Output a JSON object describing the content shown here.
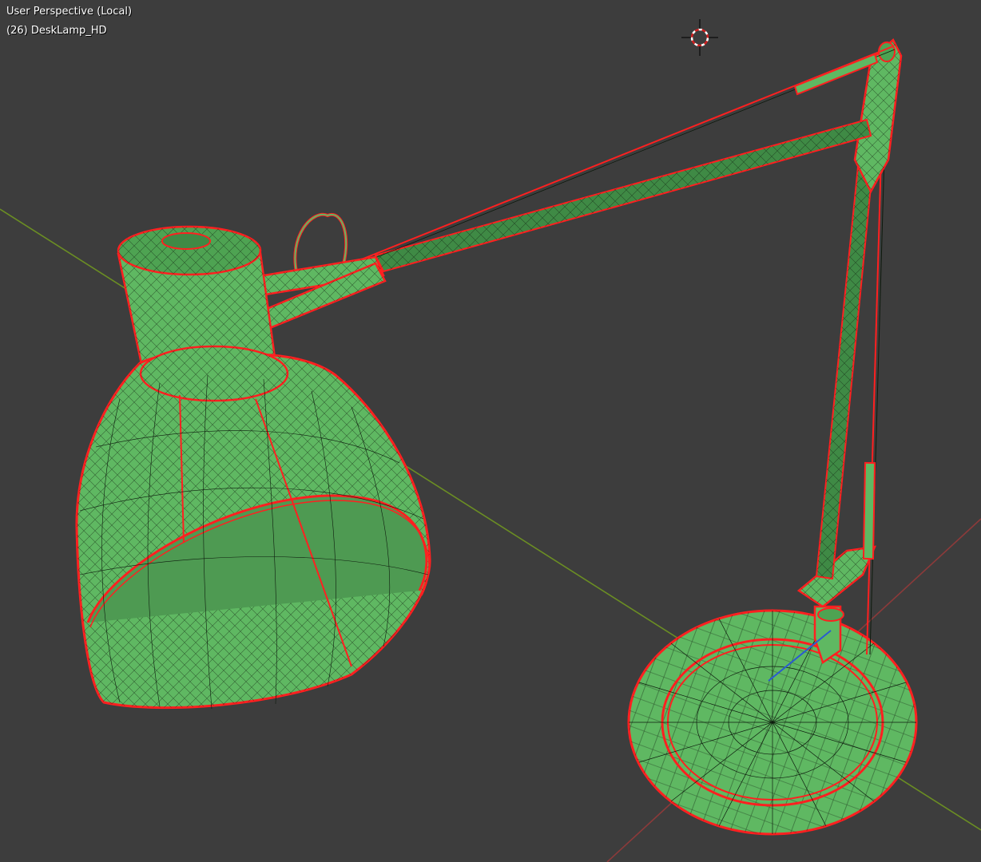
{
  "viewport": {
    "view_label": "User Perspective (Local)",
    "object_label": "(26) DeskLamp_HD",
    "background_color": "#3d3d3d"
  },
  "scene": {
    "object_name": "DeskLamp_HD",
    "display_mode": "wireframe-over-solid",
    "mesh_fill_color": "#5fb862",
    "mesh_wire_color": "#0d1a0d",
    "selection_outline_color": "#ff2020",
    "x_axis_color": "#8c3a3a",
    "y_axis_color": "#6b8e23",
    "cursor_icon": "3d-cursor-icon"
  }
}
